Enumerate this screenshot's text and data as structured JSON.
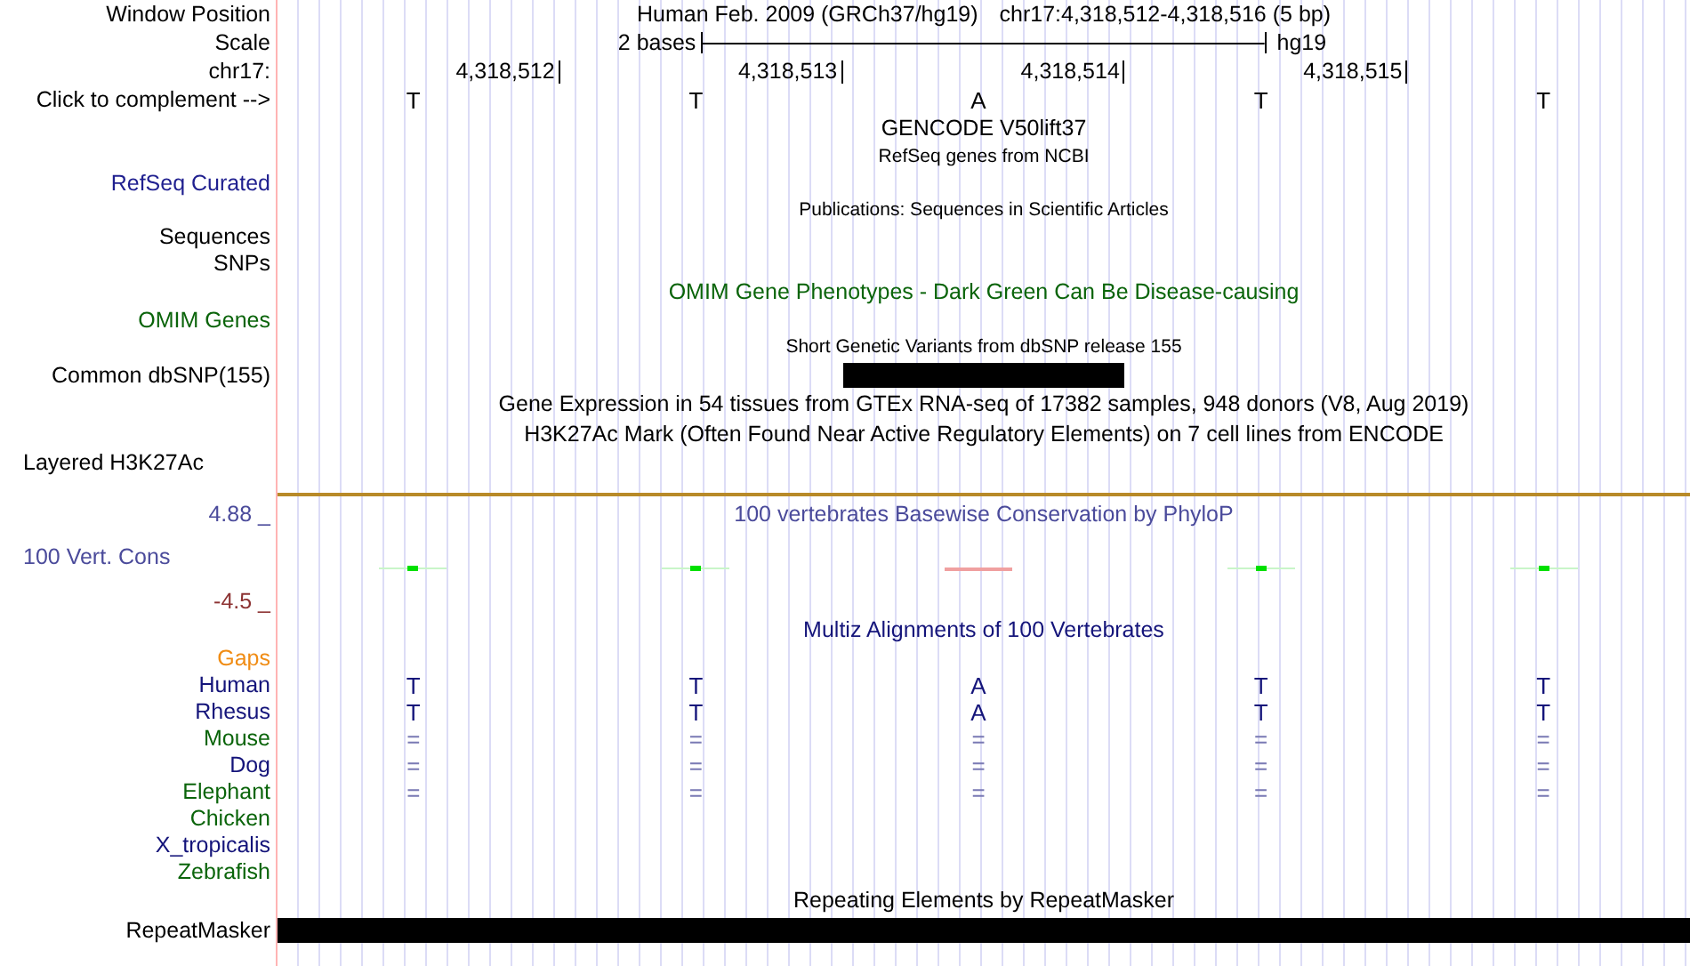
{
  "rows": [
    {
      "kind": "position",
      "label": "Window Position",
      "assembly": "Human Feb. 2009 (GRCh37/hg19)",
      "position": "chr17:4,318,512-4,318,516 (5 bp)"
    },
    {
      "kind": "scale",
      "label": "Scale",
      "length": "2 bases",
      "assembly": "hg19"
    },
    {
      "kind": "ruler",
      "label": "chr17:",
      "ticks": [
        "4,318,512",
        "4,318,513",
        "4,318,514",
        "4,318,515"
      ]
    },
    {
      "kind": "bases",
      "label": "Click to complement -->",
      "bases": [
        "T",
        "T",
        "A",
        "T",
        "T"
      ]
    },
    {
      "kind": "title",
      "title": "GENCODE V50lift37"
    },
    {
      "kind": "subtitle",
      "title": "RefSeq genes from NCBI"
    },
    {
      "kind": "label",
      "label": "RefSeq Curated",
      "color": "#1f1f8f"
    },
    {
      "kind": "subtitle",
      "title": "Publications: Sequences in Scientific Articles"
    },
    {
      "kind": "label",
      "label": "Sequences"
    },
    {
      "kind": "label",
      "label": "SNPs"
    },
    {
      "kind": "title",
      "title": "OMIM Gene Phenotypes - Dark Green Can Be Disease-causing",
      "color": "#0a640a"
    },
    {
      "kind": "label",
      "label": "OMIM Genes",
      "color": "#0a640a"
    },
    {
      "kind": "subtitle",
      "title": "Short Genetic Variants from dbSNP release 155"
    },
    {
      "kind": "feature",
      "label": "Common dbSNP(155)",
      "covered": [
        false,
        false,
        true,
        false,
        false
      ]
    },
    {
      "kind": "title",
      "title": "Gene Expression in 54 tissues from GTEx RNA-seq of 17382 samples, 948 donors (V8, Aug 2019)"
    },
    {
      "kind": "title",
      "title": "H3K27Ac Mark (Often Found Near Active Regulatory Elements) on 7 cell lines from ENCODE"
    },
    {
      "kind": "composite",
      "label": "Layered H3K27Ac"
    },
    {
      "kind": "separator"
    },
    {
      "kind": "axis",
      "label": "4.88 _",
      "color": "#4b4b9b",
      "title": "100 vertebrates Basewise Conservation by PhyloP"
    },
    {
      "kind": "wiggle",
      "label": "100 Vert. Cons",
      "color": "#4b4b9b",
      "conservation": [
        {
          "kind": "positive"
        },
        {
          "kind": "positive"
        },
        {
          "kind": "negative"
        },
        {
          "kind": "positive"
        },
        {
          "kind": "positive"
        }
      ]
    },
    {
      "kind": "axis",
      "label": "-4.5 _",
      "color": "#8c3232"
    },
    {
      "kind": "title",
      "title": "Multiz Alignments of 100 Vertebrates",
      "color": "#14147a"
    },
    {
      "kind": "label",
      "label": "Gaps",
      "color": "#f08c14"
    },
    {
      "kind": "alignment",
      "label": "Human",
      "color": "#14147a",
      "bases": [
        "T",
        "T",
        "A",
        "T",
        "T"
      ]
    },
    {
      "kind": "alignment",
      "label": "Rhesus",
      "color": "#14147a",
      "bases": [
        "T",
        "T",
        "A",
        "T",
        "T"
      ]
    },
    {
      "kind": "matches",
      "label": "Mouse",
      "color": "#0a640a",
      "bases": [
        "=",
        "=",
        "=",
        "=",
        "="
      ]
    },
    {
      "kind": "matches",
      "label": "Dog",
      "color": "#14147a",
      "bases": [
        "=",
        "=",
        "=",
        "=",
        "="
      ]
    },
    {
      "kind": "matches",
      "label": "Elephant",
      "color": "#0a640a",
      "bases": [
        "=",
        "=",
        "=",
        "=",
        "="
      ]
    },
    {
      "kind": "label",
      "label": "Chicken",
      "color": "#0a640a"
    },
    {
      "kind": "label",
      "label": "X_tropicalis",
      "color": "#14147a"
    },
    {
      "kind": "label",
      "label": "Zebrafish",
      "color": "#0a640a"
    },
    {
      "kind": "title",
      "title": "Repeating Elements by RepeatMasker"
    },
    {
      "kind": "feature",
      "label": "RepeatMasker",
      "covered": [
        true,
        true,
        true,
        true,
        true
      ]
    }
  ]
}
